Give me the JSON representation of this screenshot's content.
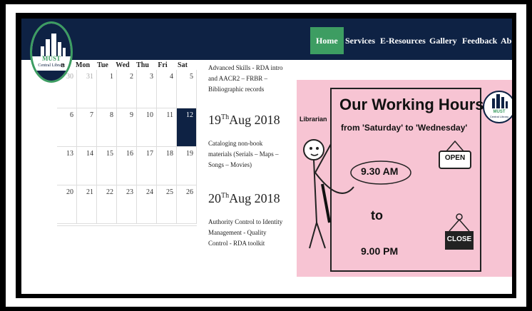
{
  "nav": {
    "logo": {
      "name": "MUST",
      "sub": "Central Library"
    },
    "items": [
      {
        "label": "Home",
        "active": true
      },
      {
        "label": "Services"
      },
      {
        "label": "E-Resources"
      },
      {
        "label": "Gallery"
      },
      {
        "label": "Feedback"
      },
      {
        "label": "About"
      }
    ]
  },
  "calendar": {
    "days": [
      "n",
      "Mon",
      "Tue",
      "Wed",
      "Thu",
      "Fri",
      "Sat"
    ],
    "weeks": [
      [
        "",
        "30",
        "31",
        "1",
        "2",
        "3",
        "4",
        "5"
      ],
      [
        "",
        "6",
        "7",
        "8",
        "9",
        "10",
        "11",
        "12"
      ],
      [
        "",
        "13",
        "14",
        "15",
        "16",
        "17",
        "18",
        "19"
      ],
      [
        "",
        "20",
        "21",
        "22",
        "23",
        "24",
        "25",
        "26"
      ]
    ],
    "selected": "12"
  },
  "events": [
    {
      "text": "Advanced Skills - RDA intro and AACR2 – FRBR – Bibliographic records"
    },
    {
      "day": "19",
      "sup": "Th",
      "month": "Aug 2018",
      "text": "Cataloging non-book materials (Serials – Maps – Songs – Movies)"
    },
    {
      "day": "20",
      "sup": "Th",
      "month": "Aug 2018",
      "text": "Authority Control to Identity Management - Quality Control - RDA toolkit"
    }
  ],
  "poster": {
    "title": "Our Working Hours",
    "subtitle": "from 'Saturday' to 'Wednesday'",
    "librarian": "Librarian",
    "open_time": "9.30 AM",
    "to": "to",
    "close_time": "9.00 PM",
    "open_sign": "OPEN",
    "close_sign": "CLOSE",
    "logo_name": "MUST",
    "logo_sub": "Central Library"
  },
  "colors": {
    "navbar": "#0e2244",
    "active": "#3d9d62",
    "poster_bg": "#f7c4d3"
  }
}
